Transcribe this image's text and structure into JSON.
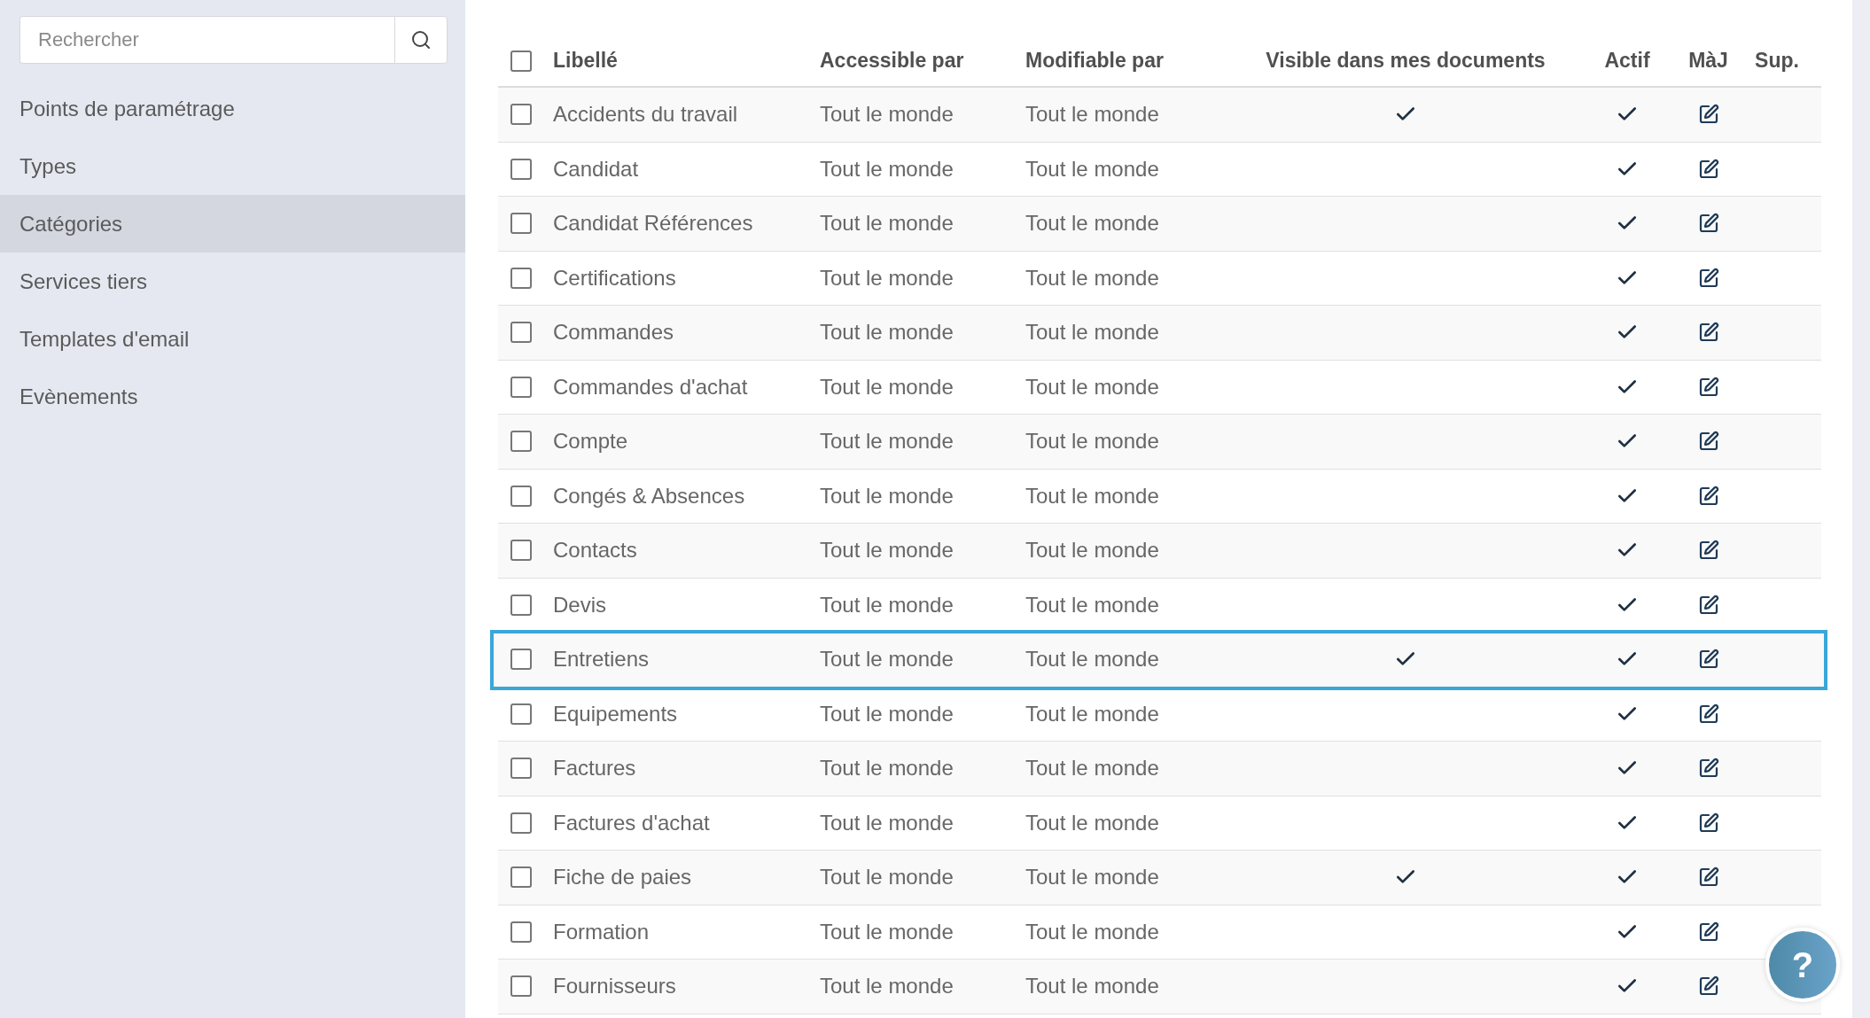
{
  "sidebar": {
    "search": {
      "placeholder": "Rechercher"
    },
    "items": [
      {
        "label": "Points de paramétrage",
        "selected": false
      },
      {
        "label": "Types",
        "selected": false
      },
      {
        "label": "Catégories",
        "selected": true
      },
      {
        "label": "Services tiers",
        "selected": false
      },
      {
        "label": "Templates d'email",
        "selected": false
      },
      {
        "label": "Evènements",
        "selected": false
      }
    ]
  },
  "table": {
    "select_all": {
      "checked": false
    },
    "columns": [
      "Libellé",
      "Accessible par",
      "Modifiable par",
      "Visible dans mes documents",
      "Actif",
      "MàJ",
      "Sup."
    ],
    "rows": [
      {
        "label": "Accidents du travail",
        "accessible": "Tout le monde",
        "modifiable": "Tout le monde",
        "visible": true,
        "active": true,
        "checked": false,
        "highlighted": false
      },
      {
        "label": "Candidat",
        "accessible": "Tout le monde",
        "modifiable": "Tout le monde",
        "visible": false,
        "active": true,
        "checked": false,
        "highlighted": false
      },
      {
        "label": "Candidat Références",
        "accessible": "Tout le monde",
        "modifiable": "Tout le monde",
        "visible": false,
        "active": true,
        "checked": false,
        "highlighted": false
      },
      {
        "label": "Certifications",
        "accessible": "Tout le monde",
        "modifiable": "Tout le monde",
        "visible": false,
        "active": true,
        "checked": false,
        "highlighted": false
      },
      {
        "label": "Commandes",
        "accessible": "Tout le monde",
        "modifiable": "Tout le monde",
        "visible": false,
        "active": true,
        "checked": false,
        "highlighted": false
      },
      {
        "label": "Commandes d'achat",
        "accessible": "Tout le monde",
        "modifiable": "Tout le monde",
        "visible": false,
        "active": true,
        "checked": false,
        "highlighted": false
      },
      {
        "label": "Compte",
        "accessible": "Tout le monde",
        "modifiable": "Tout le monde",
        "visible": false,
        "active": true,
        "checked": false,
        "highlighted": false
      },
      {
        "label": "Congés & Absences",
        "accessible": "Tout le monde",
        "modifiable": "Tout le monde",
        "visible": false,
        "active": true,
        "checked": false,
        "highlighted": false
      },
      {
        "label": "Contacts",
        "accessible": "Tout le monde",
        "modifiable": "Tout le monde",
        "visible": false,
        "active": true,
        "checked": false,
        "highlighted": false
      },
      {
        "label": "Devis",
        "accessible": "Tout le monde",
        "modifiable": "Tout le monde",
        "visible": false,
        "active": true,
        "checked": false,
        "highlighted": false
      },
      {
        "label": "Entretiens",
        "accessible": "Tout le monde",
        "modifiable": "Tout le monde",
        "visible": true,
        "active": true,
        "checked": false,
        "highlighted": true
      },
      {
        "label": "Equipements",
        "accessible": "Tout le monde",
        "modifiable": "Tout le monde",
        "visible": false,
        "active": true,
        "checked": false,
        "highlighted": false
      },
      {
        "label": "Factures",
        "accessible": "Tout le monde",
        "modifiable": "Tout le monde",
        "visible": false,
        "active": true,
        "checked": false,
        "highlighted": false
      },
      {
        "label": "Factures d'achat",
        "accessible": "Tout le monde",
        "modifiable": "Tout le monde",
        "visible": false,
        "active": true,
        "checked": false,
        "highlighted": false
      },
      {
        "label": "Fiche de paies",
        "accessible": "Tout le monde",
        "modifiable": "Tout le monde",
        "visible": true,
        "active": true,
        "checked": false,
        "highlighted": false
      },
      {
        "label": "Formation",
        "accessible": "Tout le monde",
        "modifiable": "Tout le monde",
        "visible": false,
        "active": true,
        "checked": false,
        "highlighted": false
      },
      {
        "label": "Fournisseurs",
        "accessible": "Tout le monde",
        "modifiable": "Tout le monde",
        "visible": false,
        "active": true,
        "checked": false,
        "highlighted": false
      }
    ]
  },
  "help_button": {
    "label": "?"
  }
}
